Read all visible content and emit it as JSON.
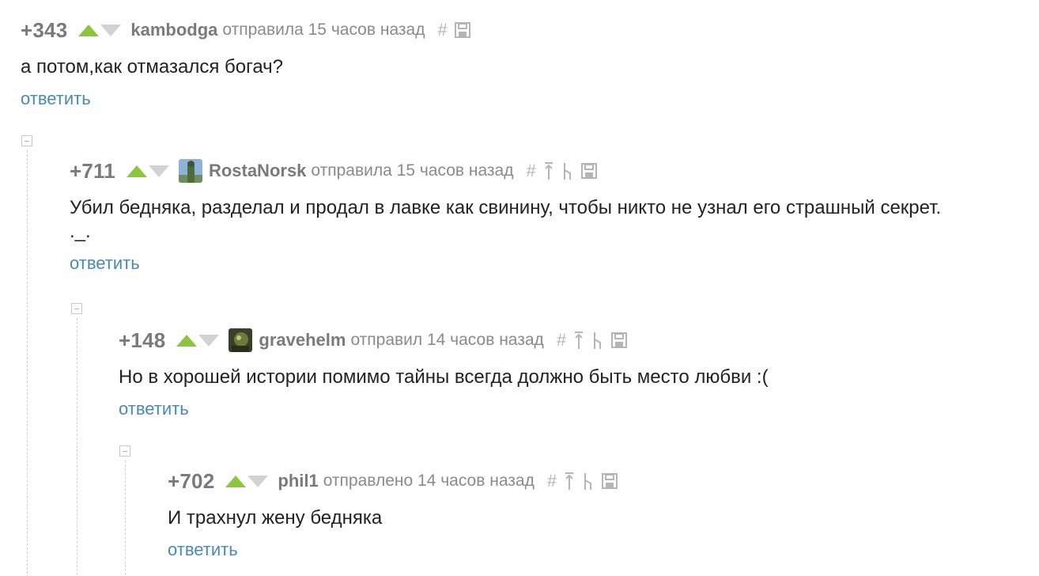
{
  "comments": [
    {
      "rating": "+343",
      "author": "kambodga",
      "meta": "отправила 15 часов назад",
      "text_line1": "а потом,как отмазался богач?",
      "text_line2": "",
      "reply_label": "ответить",
      "tools": [
        "hash-icon",
        "save-icon"
      ],
      "has_avatar": false
    },
    {
      "rating": "+711",
      "author": "RostaNorsk",
      "meta": "отправила 15 часов назад",
      "text_line1": "Убил бедняка, разделал и продал в лавке как свинину, чтобы никто не узнал его страшный секрет.",
      "text_line2": "._.",
      "reply_label": "ответить",
      "tools": [
        "hash-icon",
        "parent-arrow-icon",
        "branch-icon",
        "save-icon"
      ],
      "has_avatar": true
    },
    {
      "rating": "+148",
      "author": "gravehelm",
      "meta": "отправил 14 часов назад",
      "text_line1": "Но в хорошей истории помимо тайны всегда должно быть место любви :(",
      "text_line2": "",
      "reply_label": "ответить",
      "tools": [
        "hash-icon",
        "parent-arrow-icon",
        "branch-icon",
        "save-icon"
      ],
      "has_avatar": true
    },
    {
      "rating": "+702",
      "author": "phil1",
      "meta": "отправлено 14 часов назад",
      "text_line1": "И трахнул жену бедняка",
      "text_line2": "",
      "reply_label": "ответить",
      "tools": [
        "hash-icon",
        "parent-arrow-icon",
        "branch-icon",
        "save-icon"
      ],
      "has_avatar": false
    }
  ],
  "colors": {
    "upvote": "#8cc63e",
    "downvote": "#d2d2d2",
    "reply_link": "#4a89b0",
    "muted_text": "#7a7a7a"
  }
}
